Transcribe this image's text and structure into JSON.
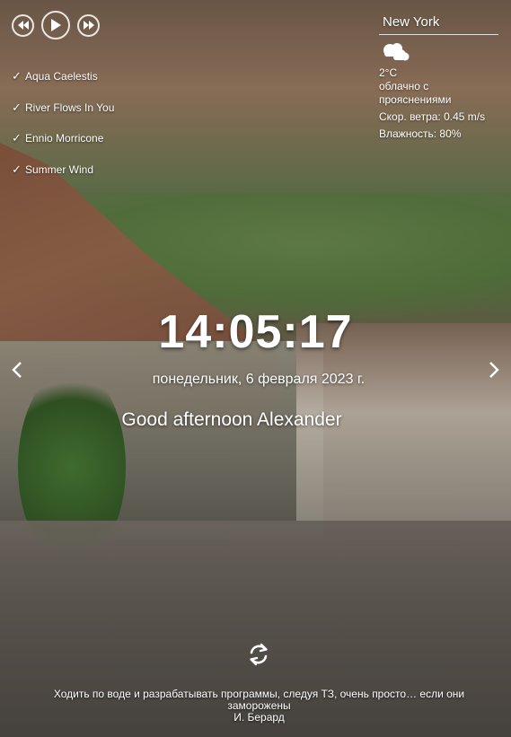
{
  "player": {
    "prev_icon": "rewind-icon",
    "play_icon": "play-icon",
    "next_icon": "fast-forward-icon",
    "tracks": [
      {
        "label": "Aqua Caelestis"
      },
      {
        "label": "River Flows In You"
      },
      {
        "label": "Ennio Morricone"
      },
      {
        "label": "Summer Wind"
      }
    ],
    "check_glyph": "✓"
  },
  "weather": {
    "city": "New York",
    "icon": "cloudy-icon",
    "temperature": "2°C",
    "description": "облачно с прояснениями",
    "wind": "Скор. ветра: 0.45 m/s",
    "humidity": "Влажность: 80%"
  },
  "clock": {
    "hours": "14",
    "minutes": "05",
    "seconds": "17",
    "separator": ":"
  },
  "date": "понедельник, 6 февраля 2023 г.",
  "greeting": "Good afternoon Alexander",
  "slider": {
    "prev_icon": "chevron-left-icon",
    "next_icon": "chevron-right-icon"
  },
  "quote": {
    "refresh_icon": "refresh-icon",
    "text": "Ходить по воде и разрабатывать программы, следуя ТЗ, очень просто… если они заморожены",
    "author": "И. Берард"
  },
  "colors": {
    "text": "#ffffff"
  }
}
